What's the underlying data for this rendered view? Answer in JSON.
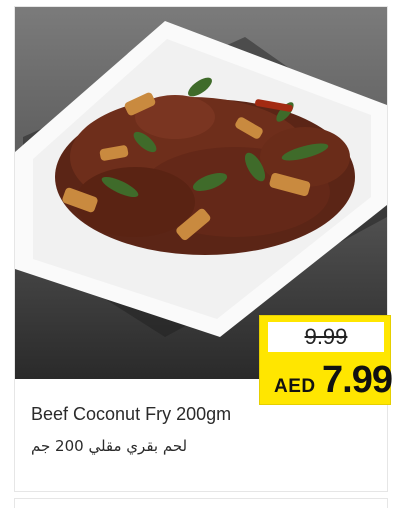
{
  "product": {
    "image_alt": "Beef coconut fry on a white square plate",
    "name_en": "Beef Coconut Fry 200gm",
    "name_ar": "لحم بقري مقلي 200 جم"
  },
  "pricing": {
    "old_price": "9.99",
    "currency": "AED",
    "new_price": "7.99"
  },
  "colors": {
    "price_tag": "#ffe600",
    "background": "#ffffff"
  }
}
